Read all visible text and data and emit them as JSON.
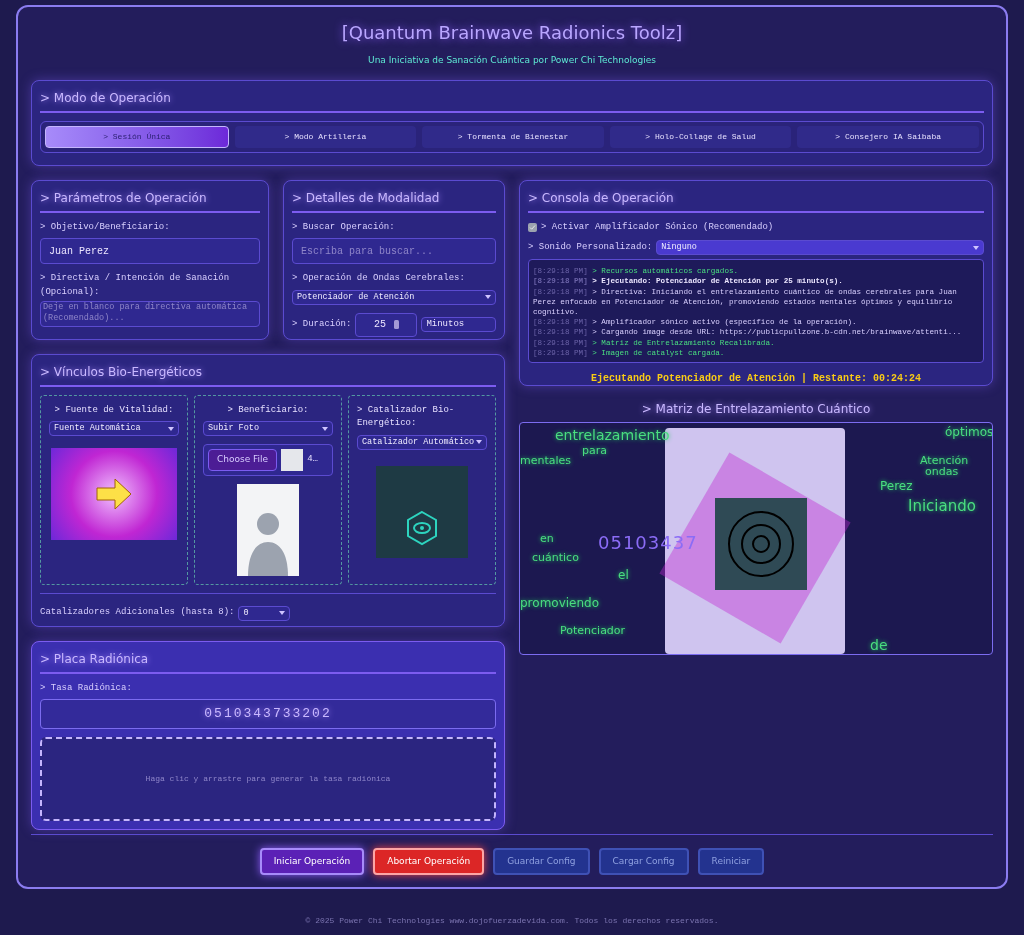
{
  "header": {
    "title": "[Quantum Brainwave Radionics Toolz]",
    "subtitle": "Una Iniciativa de Sanación Cuántica por Power Chi Technologies"
  },
  "mode": {
    "title": "> Modo de Operación",
    "tabs": [
      {
        "label": "> Sesión Única",
        "selected": true
      },
      {
        "label": "> Modo Artillería",
        "selected": false
      },
      {
        "label": "> Tormenta de Bienestar",
        "selected": false
      },
      {
        "label": "> Holo-Collage de Salud",
        "selected": false
      },
      {
        "label": "> Consejero IA Saibaba",
        "selected": false
      }
    ]
  },
  "parameters": {
    "title": "> Parámetros de Operación",
    "target_label": "> Objetivo/Beneficiario:",
    "target_value": "Juan Perez",
    "directive_label": "> Directiva / Intención de Sanación (Opcional):",
    "directive_placeholder": "Deje en blanco para directiva automática (Recomendado)..."
  },
  "modality": {
    "title": "> Detalles de Modalidad",
    "search_label": "> Buscar Operación:",
    "search_placeholder": "Escriba para buscar...",
    "operation_label": "> Operación de Ondas Cerebrales:",
    "operation_value": "Potenciador de Atención",
    "duration_label": "> Duración:",
    "duration_value": "25",
    "duration_unit": "Minutos"
  },
  "bio_links": {
    "title": "> Vínculos Bio-Energéticos",
    "cards": [
      {
        "kind": "vitality",
        "label": "> Fuente de Vitalidad:",
        "select": "Fuente Automática"
      },
      {
        "kind": "beneficiary",
        "label": "> Beneficiario:",
        "select": "Subir Foto",
        "file_button": "Choose File",
        "file_name": "4…"
      },
      {
        "kind": "catalyst",
        "label": "> Catalizador Bio-Energético:",
        "select": "Catalizador Automático"
      }
    ],
    "extra_label": "Catalizadores Adicionales (hasta 8):",
    "extra_value": "0"
  },
  "plate": {
    "title": "> Placa Radiónica",
    "rate_label": "> Tasa Radiónica:",
    "rate_value": "0510343733202",
    "pad_hint": "Haga clic y arrastre para generar la tasa radiónica"
  },
  "console": {
    "title": "> Consola de Operación",
    "amplifier": {
      "label": "> Activar Amplificador Sónico (Recomendado)",
      "checked": true
    },
    "sound_label": "> Sonido Personalizado:",
    "sound_value": "Ninguno",
    "log": [
      {
        "time": "[8:29:18 PM]",
        "text": "> Recursos automáticos cargados.",
        "kind": "success"
      },
      {
        "time": "[8:29:18 PM]",
        "text": "> Ejecutando: Potenciador de Atención por 25 minuto(s).",
        "kind": "highlight"
      },
      {
        "time": "[8:29:18 PM]",
        "text": "> Directiva: Iniciando el entrelazamiento cuántico de ondas cerebrales para Juan Perez enfocado en Potenciador de Atención, promoviendo estados mentales óptimos y equilibrio cognitivo.",
        "kind": "info"
      },
      {
        "time": "[8:29:18 PM]",
        "text": "> Amplificador sónico activo (específico de la operación).",
        "kind": "info"
      },
      {
        "time": "[8:29:18 PM]",
        "text": "> Cargando image desde URL: https://publicpullzone.b-cdn.net/brainwave/attenti...",
        "kind": "info"
      },
      {
        "time": "[8:29:18 PM]",
        "text": "> Matriz de Entrelazamiento Recalibrada.",
        "kind": "success"
      },
      {
        "time": "[8:29:18 PM]",
        "text": "> Imagen de catalyst cargada.",
        "kind": "success"
      }
    ],
    "status": "Ejecutando Potenciador de Atención | Restante: 00:24:24"
  },
  "matrix": {
    "title": "> Matriz de Entrelazamiento Cuántico",
    "rate": "05103437",
    "words": [
      "entrelazamiento",
      "para",
      "mentales",
      "óptimos",
      "Atención",
      "ondas",
      "Perez",
      "Iniciando",
      "en",
      "cuántico",
      "el",
      "promoviendo",
      "Potenciador",
      "de"
    ]
  },
  "actions": [
    {
      "label": "Iniciar Operación",
      "kind": "primary"
    },
    {
      "label": "Abortar Operación",
      "kind": "danger"
    },
    {
      "label": "Guardar Config",
      "kind": "secondary"
    },
    {
      "label": "Cargar Config",
      "kind": "secondary"
    },
    {
      "label": "Reiniciar",
      "kind": "secondary"
    }
  ],
  "footer": "© 2025 Power Chi Technologies www.dojofuerzadevida.com. Todos los derechos reservados."
}
